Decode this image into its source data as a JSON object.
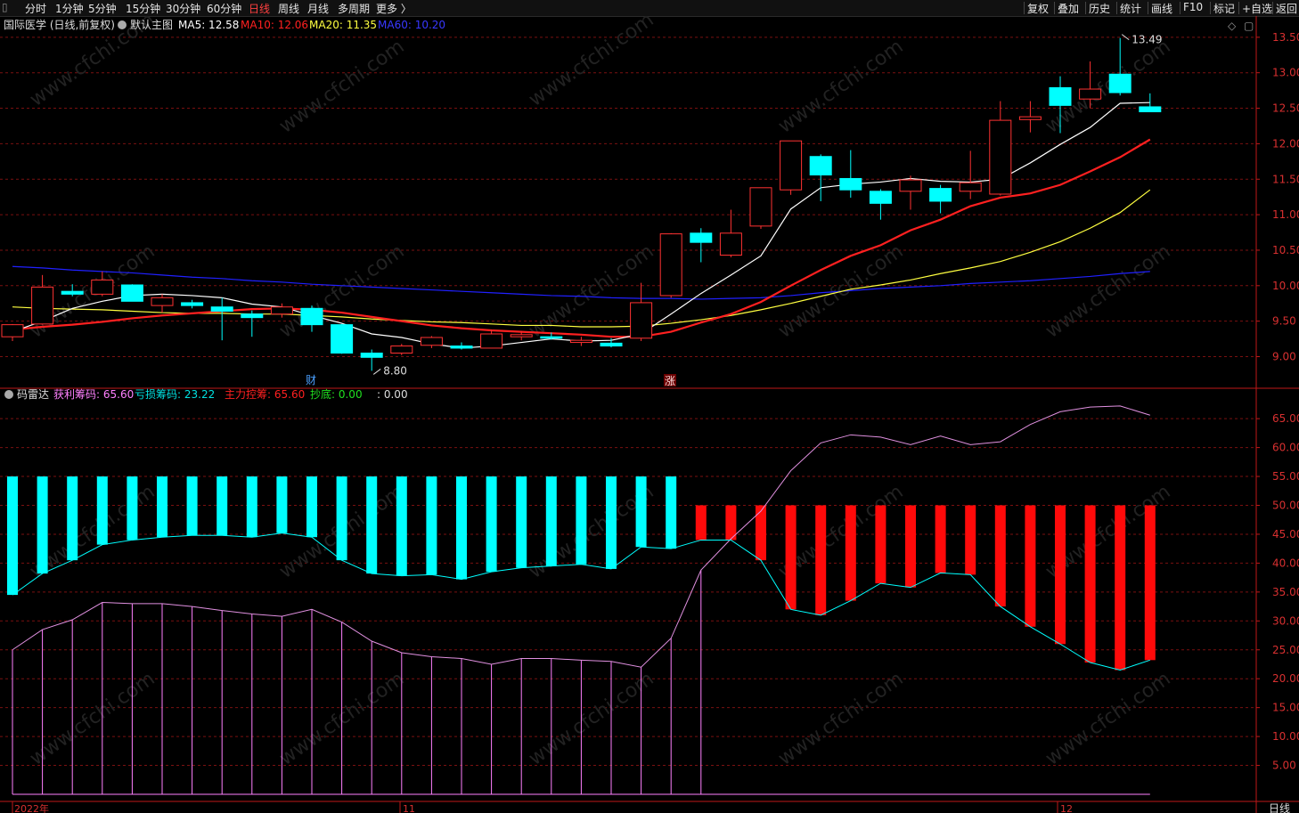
{
  "toolbar": {
    "periods": [
      {
        "label": "分时",
        "active": false
      },
      {
        "label": "1分钟",
        "active": false
      },
      {
        "label": "5分钟",
        "active": false
      },
      {
        "label": "15分钟",
        "active": false
      },
      {
        "label": "30分钟",
        "active": false
      },
      {
        "label": "60分钟",
        "active": false
      },
      {
        "label": "日线",
        "active": true
      },
      {
        "label": "周线",
        "active": false
      },
      {
        "label": "月线",
        "active": false
      },
      {
        "label": "多周期",
        "active": false
      },
      {
        "label": "更多 〉",
        "active": false
      }
    ],
    "actions": [
      "复权",
      "叠加",
      "历史",
      "统计",
      "画线",
      "F10",
      "标记",
      "+自选",
      "返回"
    ]
  },
  "main_header": {
    "stock": "国际医学 (日线,前复权)",
    "template": "默认主图",
    "ma5": "MA5: 12.58",
    "ma10": "MA10: 12.06",
    "ma20": "MA20: 11.35",
    "ma60": "MA60: 10.20"
  },
  "sub_header": {
    "name": "码雷达",
    "profit": "获利筹码: 65.60",
    "loss": "亏损筹码: 23.22",
    "main": "主力控筹: 65.60",
    "bottom": "抄底: 0.00",
    "blank": ": 0.00"
  },
  "colors": {
    "up": "#ff3232",
    "down": "#00ffff",
    "ma5": "#ffffff",
    "ma10": "#ff2020",
    "ma20": "#ffff40",
    "ma60": "#2020ff",
    "grid": "#7a1010",
    "axis": "#c01818",
    "profit_line": "#ff80ff",
    "loss_line": "#00ffff"
  },
  "annotations": {
    "high": "13.49",
    "low": "8.80",
    "marker1": "财",
    "marker2": "涨"
  },
  "x_labels": [
    "2022年",
    "11",
    "12"
  ],
  "period_label": "日线",
  "chart_data": [
    {
      "type": "candlestick",
      "price_axis_ticks": [
        "13.50",
        "13.00",
        "12.50",
        "12.00",
        "11.50",
        "11.00",
        "10.50",
        "10.00",
        "9.50",
        "9.00"
      ],
      "ylim": [
        8.6,
        13.6
      ],
      "ohlc": [
        [
          9.28,
          9.46,
          9.22,
          9.45
        ],
        [
          9.46,
          10.15,
          9.45,
          9.98
        ],
        [
          9.92,
          10.02,
          9.85,
          9.88
        ],
        [
          9.88,
          10.2,
          9.85,
          10.08
        ],
        [
          10.01,
          10.02,
          9.78,
          9.78
        ],
        [
          9.72,
          9.88,
          9.62,
          9.83
        ],
        [
          9.76,
          9.8,
          9.68,
          9.72
        ],
        [
          9.7,
          9.83,
          9.23,
          9.64
        ],
        [
          9.6,
          9.65,
          9.28,
          9.55
        ],
        [
          9.6,
          9.75,
          9.55,
          9.7
        ],
        [
          9.68,
          9.72,
          9.35,
          9.45
        ],
        [
          9.45,
          9.46,
          9.04,
          9.05
        ],
        [
          9.05,
          9.1,
          8.8,
          8.99
        ],
        [
          9.05,
          9.18,
          9.02,
          9.15
        ],
        [
          9.16,
          9.29,
          9.12,
          9.27
        ],
        [
          9.15,
          9.2,
          9.1,
          9.12
        ],
        [
          9.12,
          9.38,
          9.12,
          9.32
        ],
        [
          9.28,
          9.36,
          9.23,
          9.31
        ],
        [
          9.28,
          9.34,
          9.24,
          9.26
        ],
        [
          9.2,
          9.28,
          9.15,
          9.23
        ],
        [
          9.19,
          9.26,
          9.13,
          9.15
        ],
        [
          9.26,
          10.04,
          9.22,
          9.76
        ],
        [
          9.86,
          10.74,
          9.83,
          10.73
        ],
        [
          10.74,
          10.81,
          10.33,
          10.61
        ],
        [
          10.43,
          11.07,
          10.4,
          10.74
        ],
        [
          10.84,
          11.38,
          10.8,
          11.38
        ],
        [
          11.35,
          11.86,
          11.28,
          12.04
        ],
        [
          11.82,
          11.85,
          11.19,
          11.56
        ],
        [
          11.51,
          11.91,
          11.24,
          11.35
        ],
        [
          11.33,
          11.36,
          10.93,
          11.16
        ],
        [
          11.33,
          11.55,
          11.07,
          11.49
        ],
        [
          11.37,
          11.42,
          11.02,
          11.19
        ],
        [
          11.33,
          11.9,
          11.22,
          11.45
        ],
        [
          11.29,
          12.6,
          11.27,
          12.33
        ],
        [
          12.34,
          12.6,
          12.16,
          12.38
        ],
        [
          12.79,
          12.95,
          12.15,
          12.54
        ],
        [
          12.63,
          13.16,
          12.5,
          12.77
        ],
        [
          12.98,
          13.49,
          12.68,
          12.72
        ],
        [
          12.52,
          12.71,
          12.45,
          12.45
        ]
      ],
      "ma5": [
        9.35,
        9.5,
        9.68,
        9.78,
        9.86,
        9.88,
        9.86,
        9.83,
        9.74,
        9.7,
        9.58,
        9.47,
        9.32,
        9.27,
        9.18,
        9.12,
        9.15,
        9.2,
        9.25,
        9.22,
        9.23,
        9.32,
        9.6,
        9.89,
        10.15,
        10.42,
        11.08,
        11.38,
        11.43,
        11.46,
        11.51,
        11.47,
        11.46,
        11.5,
        11.73,
        11.99,
        12.23,
        12.57,
        12.58
      ],
      "ma10": [
        9.38,
        9.42,
        9.45,
        9.49,
        9.54,
        9.58,
        9.61,
        9.64,
        9.67,
        9.68,
        9.66,
        9.62,
        9.56,
        9.5,
        9.44,
        9.4,
        9.37,
        9.35,
        9.33,
        9.31,
        9.28,
        9.28,
        9.35,
        9.48,
        9.6,
        9.77,
        10.0,
        10.22,
        10.42,
        10.57,
        10.78,
        10.93,
        11.12,
        11.24,
        11.3,
        11.42,
        11.61,
        11.81,
        12.06
      ],
      "ma20": [
        9.7,
        9.68,
        9.67,
        9.66,
        9.64,
        9.62,
        9.61,
        9.61,
        9.6,
        9.6,
        9.58,
        9.56,
        9.53,
        9.51,
        9.49,
        9.48,
        9.46,
        9.44,
        9.44,
        9.42,
        9.42,
        9.43,
        9.47,
        9.52,
        9.58,
        9.66,
        9.75,
        9.85,
        9.95,
        10.01,
        10.08,
        10.17,
        10.25,
        10.34,
        10.47,
        10.62,
        10.81,
        11.03,
        11.35
      ],
      "ma60": [
        10.27,
        10.25,
        10.22,
        10.2,
        10.18,
        10.15,
        10.12,
        10.1,
        10.07,
        10.05,
        10.02,
        10.0,
        9.98,
        9.96,
        9.94,
        9.92,
        9.9,
        9.88,
        9.86,
        9.85,
        9.83,
        9.82,
        9.82,
        9.81,
        9.82,
        9.83,
        9.86,
        9.9,
        9.93,
        9.96,
        9.98,
        10.0,
        10.03,
        10.05,
        10.07,
        10.1,
        10.13,
        10.17,
        10.2
      ]
    },
    {
      "type": "bar",
      "y_axis_ticks": [
        "65.00",
        "60.00",
        "55.00",
        "50.00",
        "45.00",
        "40.00",
        "35.00",
        "30.00",
        "25.00",
        "20.00",
        "15.00",
        "10.00",
        "5.00"
      ],
      "ylim": [
        0,
        69
      ],
      "series": [
        {
          "name": "获利筹码",
          "values": [
            25.0,
            28.5,
            30.2,
            33.2,
            33.0,
            33.0,
            32.5,
            31.8,
            31.2,
            30.8,
            32.0,
            29.8,
            26.5,
            24.5,
            23.8,
            23.5,
            22.5,
            23.5,
            23.5,
            23.2,
            23.0,
            22.0,
            27.0,
            38.8,
            44.2,
            49.0,
            56.0,
            60.8,
            62.2,
            61.8,
            60.5,
            62.0,
            60.5,
            61.0,
            64.0,
            66.2,
            67.0,
            67.2,
            65.6
          ]
        },
        {
          "name": "亏损筹码",
          "values": [
            34.5,
            38.2,
            40.5,
            43.2,
            44.0,
            44.5,
            44.8,
            44.8,
            44.5,
            45.2,
            44.5,
            40.5,
            38.2,
            37.8,
            38.0,
            37.2,
            38.5,
            39.2,
            39.5,
            39.8,
            39.0,
            42.8,
            42.5,
            44.0,
            44.0,
            40.5,
            32.0,
            31.0,
            33.5,
            36.5,
            35.8,
            38.3,
            38.0,
            32.5,
            29.0,
            26.0,
            22.8,
            21.5,
            23.22
          ]
        },
        {
          "name": "主力控筹",
          "values": [
            55,
            55,
            55,
            55,
            55,
            55,
            55,
            55,
            55,
            55,
            55,
            55,
            55,
            55,
            55,
            55,
            55,
            55,
            55,
            55,
            55,
            55,
            55,
            50,
            50,
            50,
            50,
            50,
            50,
            50,
            50,
            50,
            50,
            50,
            50,
            50,
            50,
            50,
            50
          ]
        }
      ]
    }
  ]
}
